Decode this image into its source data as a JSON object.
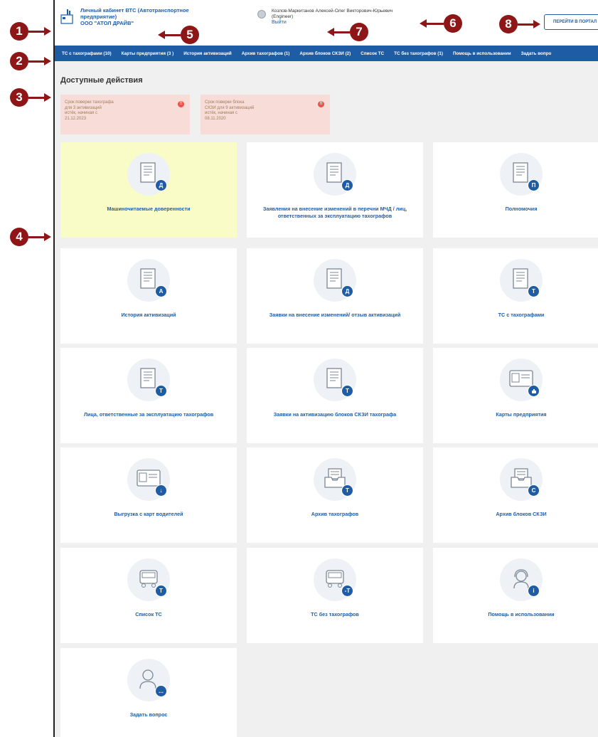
{
  "header": {
    "org_title_line1": "Личный кабинет ВТС (Автотранспортное",
    "org_title_line2": "предприятие)",
    "org_name": "ООО \"АТОЛ ДРАЙВ\"",
    "user_name": "Козлов-Маркитанов Алексей-Олег Викторович-Юрьевич",
    "user_role": "(Engineer)",
    "logout_label": "Выйти",
    "portal_button": "ПЕРЕЙТИ В ПОРТАЛ"
  },
  "nav": {
    "items": [
      {
        "label": "ТС с тахографами (10)"
      },
      {
        "label": "Карты предприятия (3 )"
      },
      {
        "label": "История активизаций"
      },
      {
        "label": "Архив тахографов (1)"
      },
      {
        "label": "Архив блоков СКЗИ (2)"
      },
      {
        "label": "Список ТС"
      },
      {
        "label": "ТС без тахографов (1)"
      },
      {
        "label": "Помощь в использовании"
      },
      {
        "label": "Задать вопро"
      }
    ]
  },
  "section_title": "Доступные действия",
  "alerts": [
    {
      "line1": "Срок поверки тахографа",
      "line2": "для 3 активизаций",
      "line3": "истёк, начиная с",
      "line4": "21.12.2023",
      "badge": "!!"
    },
    {
      "line1": "Срок поверки блока",
      "line2": "СКЗИ для 9 активизаций",
      "line3": "истёк, начиная с",
      "line4": "08.11.2020",
      "badge": "!!"
    }
  ],
  "cards": [
    {
      "label": "Машиночитаемые доверенности",
      "badge": "Д",
      "icon": "document-icon"
    },
    {
      "label": "Заявления на внесение изменений в перечни МЧД / лиц, ответственных за эксплуатацию тахографов",
      "badge": "Д",
      "icon": "document-icon"
    },
    {
      "label": "Полномочия",
      "badge": "П",
      "icon": "document-icon"
    },
    {
      "label": "История активизаций",
      "badge": "А",
      "icon": "document-icon"
    },
    {
      "label": "Заявки на внесение изменений/ отзыв активизаций",
      "badge": "Д",
      "icon": "document-icon"
    },
    {
      "label": "ТС с тахографами",
      "badge": "Т",
      "icon": "document-icon"
    },
    {
      "label": "Лица, ответственные за эксплуатацию тахографов",
      "badge": "Т",
      "icon": "document-icon"
    },
    {
      "label": "Заявки на активизацию блоков СКЗИ тахографа",
      "badge": "Т",
      "icon": "document-icon"
    },
    {
      "label": "Карты предприятия",
      "badge": "",
      "icon": "card-icon"
    },
    {
      "label": "Выгрузка с карт водителей",
      "badge": "↓",
      "icon": "card-icon"
    },
    {
      "label": "Архив тахографов",
      "badge": "Т",
      "icon": "archive-icon"
    },
    {
      "label": "Архив блоков СКЗИ",
      "badge": "С",
      "icon": "archive-icon"
    },
    {
      "label": "Список ТС",
      "badge": "Т",
      "icon": "truck-icon"
    },
    {
      "label": "ТС без тахографов",
      "badge": "-T",
      "icon": "truck-icon"
    },
    {
      "label": "Помощь в использовании",
      "badge": "i",
      "icon": "support-icon"
    },
    {
      "label": "Задать вопрос",
      "badge": "...",
      "icon": "user-question-icon"
    }
  ],
  "callouts": [
    "1",
    "2",
    "3",
    "4",
    "5",
    "6",
    "7",
    "8"
  ],
  "colors": {
    "accent": "#1e5ca6",
    "callout": "#8e1616",
    "highlight": "#fafcc8",
    "alert_bg": "#f7dcd7"
  }
}
